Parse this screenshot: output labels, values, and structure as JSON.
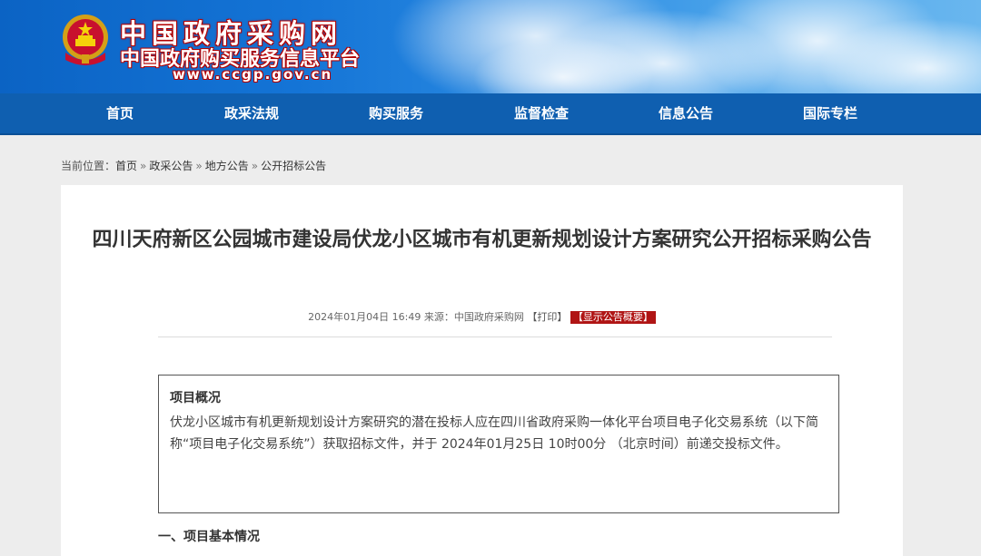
{
  "banner": {
    "site_title": "中国政府采购网",
    "site_subtitle": "中国政府购买服务信息平台",
    "site_url": "www.ccgp.gov.cn",
    "emblem_icon": "national-emblem-icon"
  },
  "nav": {
    "items": [
      {
        "label": "首页"
      },
      {
        "label": "政采法规"
      },
      {
        "label": "购买服务"
      },
      {
        "label": "监督检查"
      },
      {
        "label": "信息公告"
      },
      {
        "label": "国际专栏"
      }
    ]
  },
  "breadcrumb": {
    "prefix": "当前位置：",
    "items": [
      {
        "label": "首页"
      },
      {
        "label": "政采公告"
      },
      {
        "label": "地方公告"
      },
      {
        "label": "公开招标公告"
      }
    ],
    "separator": "»"
  },
  "article": {
    "title": "四川天府新区公园城市建设局伏龙小区城市有机更新规划设计方案研究公开招标采购公告",
    "date": "2024年01月04日 16:49",
    "source_label": "来源：",
    "source": "中国政府采购网",
    "print_label": "【打印】",
    "summary_button": "【显示公告概要】",
    "overview": {
      "title": "项目概况",
      "text": "伏龙小区城市有机更新规划设计方案研究的潜在投标人应在四川省政府采购一体化平台项目电子化交易系统（以下简称“项目电子化交易系统”）获取招标文件，并于 2024年01月25日 10时00分 （北京时间）前递交投标文件。"
    },
    "section_heading": "一、项目基本情况"
  },
  "colors": {
    "nav_bg": "#0f5fb0",
    "banner_blue": "#1474d6",
    "summary_red": "#b01515",
    "page_bg": "#ededed"
  }
}
